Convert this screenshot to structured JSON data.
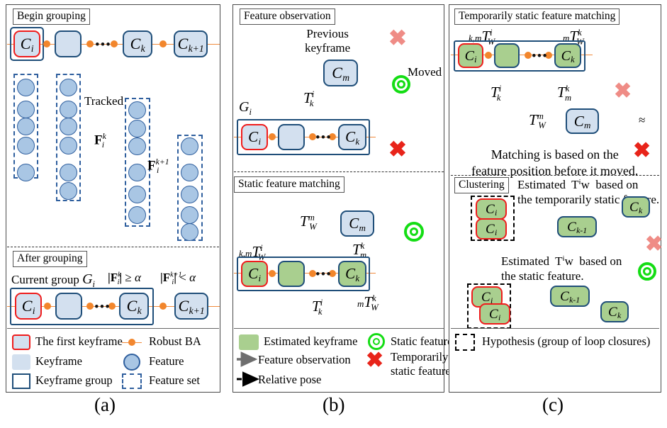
{
  "figure": {
    "captions": {
      "a": "(a)",
      "b": "(b)",
      "c": "(c)"
    }
  },
  "panel_a": {
    "title_top": "Begin grouping",
    "title_bottom": "After grouping",
    "keyframes_top": [
      {
        "label": "C",
        "sub": "i",
        "first": true
      },
      {
        "label": "",
        "sub": ""
      },
      {
        "label": "C",
        "sub": "k"
      },
      {
        "label": "C",
        "sub": "k+1"
      }
    ],
    "tracked_label": "Tracked",
    "f_k_label": "F",
    "f_k_sup": "k",
    "f_k_sub": "i",
    "f_k1_sup": "k+1",
    "current_group_label": "Current group",
    "current_group_name": "G",
    "current_group_sub": "i",
    "cond_k": "|Fⁱᵏ| ≥ α",
    "cond_k1": "|Fⁱᵏ⁺¹| < α",
    "keyframes_bottom": [
      {
        "label": "C",
        "sub": "i",
        "first": true
      },
      {
        "label": "",
        "sub": ""
      },
      {
        "label": "C",
        "sub": "k"
      },
      {
        "label": "C",
        "sub": "k+1"
      }
    ],
    "legend": [
      {
        "icon": "first-keyframe-swatch",
        "text": "The first keyframe"
      },
      {
        "icon": "robust-ba-swatch",
        "text": "Robust BA"
      },
      {
        "icon": "keyframe-swatch",
        "text": "Keyframe"
      },
      {
        "icon": "feature-swatch",
        "text": "Feature"
      },
      {
        "icon": "keyframe-group-swatch",
        "text": "Keyframe group"
      },
      {
        "icon": "feature-set-swatch",
        "text": "Feature set"
      }
    ]
  },
  "panel_b": {
    "title_top": "Feature observation",
    "title_bottom": "Static feature matching",
    "previous_keyframe_label": "Previous\nkeyframe",
    "prev_keyframe": {
      "label": "C",
      "sub": "m"
    },
    "moved_label": "Moved",
    "group_label": "G",
    "group_sub": "i",
    "pose_T_k_i": "T",
    "pose_T_k_i_sup": "i",
    "pose_T_k_i_sub": "k",
    "group_keyframes": [
      {
        "label": "C",
        "sub": "i",
        "first": true
      },
      {
        "label": "",
        "sub": ""
      },
      {
        "label": "C",
        "sub": "k"
      }
    ],
    "static_labels": {
      "T_W_m": "T",
      "T_W_m_sup": "m",
      "T_W_m_sub": "W",
      "T_m_k": "T",
      "T_m_k_sup": "k",
      "T_m_k_sub": "m",
      "T_W_i_prefix": "k,m",
      "T_W_i": "T",
      "T_W_i_sup": "i",
      "T_W_i_sub": "W",
      "T_k_i": "T",
      "T_k_i_sup": "i",
      "T_k_i_sub": "k",
      "mT_W_k_prefix": "m",
      "mT_W_k": "T",
      "mT_W_k_sup": "k",
      "mT_W_k_sub": "W"
    },
    "legend": [
      {
        "icon": "estimated-keyframe-swatch",
        "text": "Estimated keyframe"
      },
      {
        "icon": "static-feature-swatch",
        "text": "Static feature"
      },
      {
        "icon": "feature-observation-arrow",
        "text": "Feature observation"
      },
      {
        "icon": "temporarily-static-feature-swatch",
        "text": "Temporarily\nstatic feature"
      },
      {
        "icon": "relative-pose-arrow",
        "text": "Relative pose"
      }
    ]
  },
  "panel_c": {
    "title_top": "Temporarily static feature matching",
    "title_bottom": "Clustering",
    "note": "Matching is based on the\nfeature position before it moved.",
    "labels": {
      "T_W_i_prefix": "k,m",
      "T_W_i": "T",
      "T_W_i_sup": "i",
      "T_W_i_sub": "W",
      "mT_W_k_prefix": "m",
      "mT_W_k": "T",
      "mT_W_k_sup": "k",
      "mT_W_k_sub": "W",
      "T_k_i": "T",
      "T_k_i_sup": "i",
      "T_k_i_sub": "k",
      "T_m_k": "T",
      "T_m_k_sup": "k",
      "T_m_k_sub": "m",
      "T_W_m": "T",
      "T_W_m_sup": "m",
      "T_W_m_sub": "W"
    },
    "group_keyframes": [
      {
        "label": "C",
        "sub": "i",
        "first": true
      },
      {
        "label": "",
        "sub": ""
      },
      {
        "label": "C",
        "sub": "k"
      }
    ],
    "prev_keyframe": {
      "label": "C",
      "sub": "m"
    },
    "cluster_note_1": "Estimated  Tⁱᴡ  based on\nthe temporarily static feature.",
    "cluster_note_2": "Estimated  Tⁱᴡ  based on\nthe static feature.",
    "cluster_1": {
      "hypothesis": [
        {
          "label": "C",
          "sub": "i"
        },
        {
          "label": "C",
          "sub": "i"
        }
      ],
      "sources": [
        {
          "label": "C",
          "sub": "k"
        },
        {
          "label": "C",
          "sub": "k-1"
        }
      ]
    },
    "cluster_2": {
      "hypothesis": [
        {
          "label": "C",
          "sub": "i"
        },
        {
          "label": "C",
          "sub": "i"
        }
      ],
      "sources": [
        {
          "label": "C",
          "sub": "k-1"
        },
        {
          "label": "C",
          "sub": "k"
        }
      ]
    },
    "legend": [
      {
        "icon": "hypothesis-swatch",
        "text": "Hypothesis (group of loop closures)"
      }
    ]
  },
  "colors": {
    "keyframe_fill": "#d3e0ef",
    "keyframe_border": "#1f4e79",
    "first_keyframe_border": "#ef1c1c",
    "estimated_keyframe_fill": "#a9cf8f",
    "robust_ba": "#f2862c",
    "feature_fill": "#a9c6e4",
    "tracked_arrow": "#2f78c4",
    "static_feature": "#14dd14",
    "temporarily_static_feature": "#e8412e",
    "observation_arrow": "#6e6e6e",
    "relative_pose_arrow": "#000000"
  }
}
